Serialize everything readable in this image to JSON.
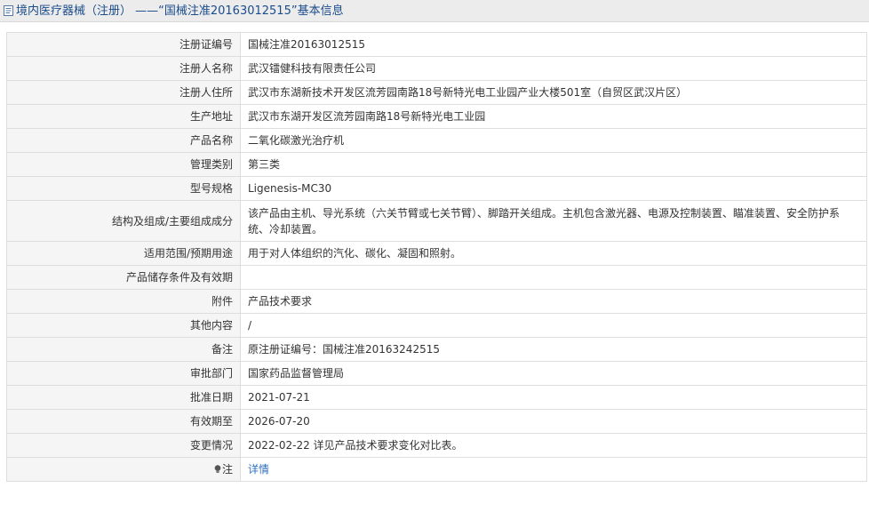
{
  "header": {
    "title": "境内医疗器械（注册） ——“国械注准20163012515”基本信息"
  },
  "rows": [
    {
      "label": "注册证编号",
      "value": "国械注准20163012515"
    },
    {
      "label": "注册人名称",
      "value": "武汉镭健科技有限责任公司"
    },
    {
      "label": "注册人住所",
      "value": "武汉市东湖新技术开发区流芳园南路18号新特光电工业园产业大楼501室（自贸区武汉片区）"
    },
    {
      "label": "生产地址",
      "value": "武汉市东湖开发区流芳园南路18号新特光电工业园"
    },
    {
      "label": "产品名称",
      "value": "二氧化碳激光治疗机"
    },
    {
      "label": "管理类别",
      "value": "第三类"
    },
    {
      "label": "型号规格",
      "value": "Ligenesis-MC30"
    },
    {
      "label": "结构及组成/主要组成成分",
      "value": "该产品由主机、导光系统（六关节臂或七关节臂）、脚踏开关组成。主机包含激光器、电源及控制装置、瞄准装置、安全防护系统、冷却装置。"
    },
    {
      "label": "适用范围/预期用途",
      "value": "用于对人体组织的汽化、碳化、凝固和照射。"
    },
    {
      "label": "产品储存条件及有效期",
      "value": ""
    },
    {
      "label": "附件",
      "value": "产品技术要求"
    },
    {
      "label": "其他内容",
      "value": "/"
    },
    {
      "label": "备注",
      "value": "原注册证编号：国械注准20163242515"
    },
    {
      "label": "审批部门",
      "value": "国家药品监督管理局"
    },
    {
      "label": "批准日期",
      "value": "2021-07-21"
    },
    {
      "label": "有效期至",
      "value": "2026-07-20"
    },
    {
      "label": "变更情况",
      "value": "2022-02-22 详见产品技术要求变化对比表。"
    }
  ],
  "note": {
    "label": "注",
    "link": "详情"
  }
}
